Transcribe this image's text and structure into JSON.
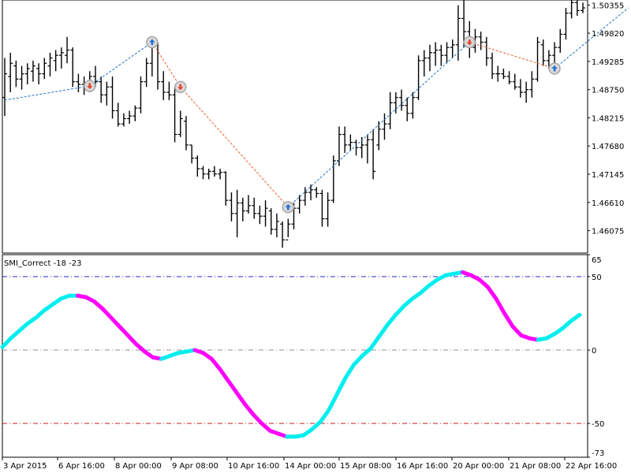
{
  "chart_data": [
    {
      "type": "ohlc",
      "price_ticks": [
        "1.50355",
        "1.49820",
        "1.49285",
        "1.48750",
        "1.48215",
        "1.47680",
        "1.47145",
        "1.46610",
        "1.46075"
      ],
      "ylim": [
        1.4565,
        1.5045
      ],
      "bars": [
        {
          "h": 1.4935,
          "l": 1.4825,
          "o": 1.486,
          "c": 1.4905
        },
        {
          "h": 1.4945,
          "l": 1.487,
          "o": 1.49,
          "c": 1.4925
        },
        {
          "h": 1.493,
          "l": 1.488,
          "o": 1.492,
          "c": 1.4895
        },
        {
          "h": 1.492,
          "l": 1.4875,
          "o": 1.4895,
          "c": 1.4905
        },
        {
          "h": 1.4925,
          "l": 1.4885,
          "o": 1.4905,
          "c": 1.4915
        },
        {
          "h": 1.493,
          "l": 1.489,
          "o": 1.491,
          "c": 1.492
        },
        {
          "h": 1.4925,
          "l": 1.4885,
          "o": 1.4915,
          "c": 1.4905
        },
        {
          "h": 1.4935,
          "l": 1.4895,
          "o": 1.4905,
          "c": 1.4925
        },
        {
          "h": 1.4945,
          "l": 1.49,
          "o": 1.492,
          "c": 1.4935
        },
        {
          "h": 1.495,
          "l": 1.491,
          "o": 1.493,
          "c": 1.494
        },
        {
          "h": 1.4955,
          "l": 1.4915,
          "o": 1.494,
          "c": 1.4945
        },
        {
          "h": 1.4975,
          "l": 1.4925,
          "o": 1.494,
          "c": 1.495
        },
        {
          "h": 1.4955,
          "l": 1.488,
          "o": 1.495,
          "c": 1.489
        },
        {
          "h": 1.4905,
          "l": 1.487,
          "o": 1.489,
          "c": 1.4885
        },
        {
          "h": 1.49,
          "l": 1.4865,
          "o": 1.4885,
          "c": 1.488
        },
        {
          "h": 1.491,
          "l": 1.487,
          "o": 1.488,
          "c": 1.49
        },
        {
          "h": 1.492,
          "l": 1.488,
          "o": 1.49,
          "c": 1.489
        },
        {
          "h": 1.49,
          "l": 1.485,
          "o": 1.489,
          "c": 1.4865
        },
        {
          "h": 1.489,
          "l": 1.4845,
          "o": 1.4865,
          "c": 1.488
        },
        {
          "h": 1.49,
          "l": 1.482,
          "o": 1.488,
          "c": 1.4835
        },
        {
          "h": 1.485,
          "l": 1.4805,
          "o": 1.4835,
          "c": 1.481
        },
        {
          "h": 1.483,
          "l": 1.4805,
          "o": 1.481,
          "c": 1.482
        },
        {
          "h": 1.4835,
          "l": 1.481,
          "o": 1.482,
          "c": 1.4825
        },
        {
          "h": 1.4845,
          "l": 1.4815,
          "o": 1.4825,
          "c": 1.484
        },
        {
          "h": 1.49,
          "l": 1.483,
          "o": 1.484,
          "c": 1.489
        },
        {
          "h": 1.4935,
          "l": 1.488,
          "o": 1.489,
          "c": 1.4925
        },
        {
          "h": 1.4975,
          "l": 1.49,
          "o": 1.4925,
          "c": 1.4965
        },
        {
          "h": 1.4965,
          "l": 1.4875,
          "o": 1.496,
          "c": 1.489
        },
        {
          "h": 1.491,
          "l": 1.4855,
          "o": 1.489,
          "c": 1.487
        },
        {
          "h": 1.489,
          "l": 1.4855,
          "o": 1.487,
          "c": 1.4865
        },
        {
          "h": 1.488,
          "l": 1.4775,
          "o": 1.4865,
          "c": 1.479
        },
        {
          "h": 1.4835,
          "l": 1.4785,
          "o": 1.479,
          "c": 1.482
        },
        {
          "h": 1.4825,
          "l": 1.476,
          "o": 1.4815,
          "c": 1.477
        },
        {
          "h": 1.477,
          "l": 1.4735,
          "o": 1.477,
          "c": 1.4745
        },
        {
          "h": 1.475,
          "l": 1.471,
          "o": 1.4745,
          "c": 1.4725
        },
        {
          "h": 1.473,
          "l": 1.4705,
          "o": 1.4725,
          "c": 1.4715
        },
        {
          "h": 1.4725,
          "l": 1.4705,
          "o": 1.4715,
          "c": 1.472
        },
        {
          "h": 1.473,
          "l": 1.471,
          "o": 1.472,
          "c": 1.4715
        },
        {
          "h": 1.4725,
          "l": 1.4705,
          "o": 1.4715,
          "c": 1.4718
        },
        {
          "h": 1.472,
          "l": 1.4655,
          "o": 1.4718,
          "c": 1.4665
        },
        {
          "h": 1.468,
          "l": 1.4625,
          "o": 1.4665,
          "c": 1.464
        },
        {
          "h": 1.4685,
          "l": 1.4595,
          "o": 1.464,
          "c": 1.466
        },
        {
          "h": 1.467,
          "l": 1.4625,
          "o": 1.466,
          "c": 1.4645
        },
        {
          "h": 1.4675,
          "l": 1.464,
          "o": 1.4645,
          "c": 1.4655
        },
        {
          "h": 1.467,
          "l": 1.463,
          "o": 1.4655,
          "c": 1.464
        },
        {
          "h": 1.4655,
          "l": 1.462,
          "o": 1.464,
          "c": 1.4635
        },
        {
          "h": 1.4665,
          "l": 1.4615,
          "o": 1.4635,
          "c": 1.465
        },
        {
          "h": 1.465,
          "l": 1.46,
          "o": 1.4645,
          "c": 1.461
        },
        {
          "h": 1.464,
          "l": 1.4595,
          "o": 1.461,
          "c": 1.4625
        },
        {
          "h": 1.4625,
          "l": 1.4575,
          "o": 1.462,
          "c": 1.459
        },
        {
          "h": 1.463,
          "l": 1.4595,
          "o": 1.459,
          "c": 1.462
        },
        {
          "h": 1.466,
          "l": 1.461,
          "o": 1.462,
          "c": 1.465
        },
        {
          "h": 1.4675,
          "l": 1.464,
          "o": 1.465,
          "c": 1.4665
        },
        {
          "h": 1.469,
          "l": 1.4655,
          "o": 1.4665,
          "c": 1.468
        },
        {
          "h": 1.4695,
          "l": 1.4665,
          "o": 1.468,
          "c": 1.4685
        },
        {
          "h": 1.469,
          "l": 1.467,
          "o": 1.4685,
          "c": 1.4678
        },
        {
          "h": 1.4685,
          "l": 1.4615,
          "o": 1.4678,
          "c": 1.463
        },
        {
          "h": 1.468,
          "l": 1.4615,
          "o": 1.463,
          "c": 1.4665
        },
        {
          "h": 1.475,
          "l": 1.466,
          "o": 1.4665,
          "c": 1.474
        },
        {
          "h": 1.4805,
          "l": 1.473,
          "o": 1.474,
          "c": 1.479
        },
        {
          "h": 1.4805,
          "l": 1.4755,
          "o": 1.479,
          "c": 1.477
        },
        {
          "h": 1.479,
          "l": 1.476,
          "o": 1.477,
          "c": 1.4775
        },
        {
          "h": 1.478,
          "l": 1.475,
          "o": 1.4775,
          "c": 1.4765
        },
        {
          "h": 1.4785,
          "l": 1.4745,
          "o": 1.4765,
          "c": 1.477
        },
        {
          "h": 1.479,
          "l": 1.4735,
          "o": 1.477,
          "c": 1.478
        },
        {
          "h": 1.48,
          "l": 1.4705,
          "o": 1.478,
          "c": 1.472
        },
        {
          "h": 1.4815,
          "l": 1.476,
          "o": 1.477,
          "c": 1.48
        },
        {
          "h": 1.483,
          "l": 1.478,
          "o": 1.48,
          "c": 1.481
        },
        {
          "h": 1.487,
          "l": 1.48,
          "o": 1.481,
          "c": 1.485
        },
        {
          "h": 1.487,
          "l": 1.483,
          "o": 1.485,
          "c": 1.486
        },
        {
          "h": 1.4875,
          "l": 1.4835,
          "o": 1.486,
          "c": 1.4845
        },
        {
          "h": 1.486,
          "l": 1.4815,
          "o": 1.4845,
          "c": 1.483
        },
        {
          "h": 1.487,
          "l": 1.482,
          "o": 1.483,
          "c": 1.486
        },
        {
          "h": 1.494,
          "l": 1.4855,
          "o": 1.486,
          "c": 1.493
        },
        {
          "h": 1.495,
          "l": 1.49,
          "o": 1.493,
          "c": 1.4935
        },
        {
          "h": 1.496,
          "l": 1.491,
          "o": 1.4935,
          "c": 1.4945
        },
        {
          "h": 1.4965,
          "l": 1.492,
          "o": 1.4945,
          "c": 1.495
        },
        {
          "h": 1.496,
          "l": 1.492,
          "o": 1.495,
          "c": 1.494
        },
        {
          "h": 1.4965,
          "l": 1.4925,
          "o": 1.494,
          "c": 1.4955
        },
        {
          "h": 1.497,
          "l": 1.4935,
          "o": 1.4955,
          "c": 1.496
        },
        {
          "h": 1.5035,
          "l": 1.493,
          "o": 1.496,
          "c": 1.501
        },
        {
          "h": 1.505,
          "l": 1.4955,
          "o": 1.501,
          "c": 1.4985
        },
        {
          "h": 1.5005,
          "l": 1.4935,
          "o": 1.4985,
          "c": 1.4955
        },
        {
          "h": 1.499,
          "l": 1.4945,
          "o": 1.4955,
          "c": 1.4975
        },
        {
          "h": 1.4985,
          "l": 1.495,
          "o": 1.4975,
          "c": 1.4965
        },
        {
          "h": 1.4975,
          "l": 1.492,
          "o": 1.4965,
          "c": 1.4935
        },
        {
          "h": 1.4945,
          "l": 1.4895,
          "o": 1.4935,
          "c": 1.4905
        },
        {
          "h": 1.492,
          "l": 1.489,
          "o": 1.4905,
          "c": 1.4905
        },
        {
          "h": 1.4915,
          "l": 1.4895,
          "o": 1.4905,
          "c": 1.49
        },
        {
          "h": 1.491,
          "l": 1.4885,
          "o": 1.49,
          "c": 1.489
        },
        {
          "h": 1.4905,
          "l": 1.4875,
          "o": 1.489,
          "c": 1.488
        },
        {
          "h": 1.4895,
          "l": 1.486,
          "o": 1.488,
          "c": 1.487
        },
        {
          "h": 1.489,
          "l": 1.485,
          "o": 1.487,
          "c": 1.4875
        },
        {
          "h": 1.491,
          "l": 1.486,
          "o": 1.4875,
          "c": 1.4895
        },
        {
          "h": 1.4975,
          "l": 1.489,
          "o": 1.4895,
          "c": 1.4965
        },
        {
          "h": 1.497,
          "l": 1.492,
          "o": 1.496,
          "c": 1.493
        },
        {
          "h": 1.495,
          "l": 1.4915,
          "o": 1.493,
          "c": 1.494
        },
        {
          "h": 1.4965,
          "l": 1.4925,
          "o": 1.494,
          "c": 1.4955
        },
        {
          "h": 1.499,
          "l": 1.4945,
          "o": 1.4955,
          "c": 1.498
        },
        {
          "h": 1.503,
          "l": 1.497,
          "o": 1.498,
          "c": 1.502
        },
        {
          "h": 1.505,
          "l": 1.501,
          "o": 1.502,
          "c": 1.504
        },
        {
          "h": 1.5045,
          "l": 1.5015,
          "o": 1.504,
          "c": 1.5025
        },
        {
          "h": 1.504,
          "l": 1.502,
          "o": 1.5025,
          "c": 1.503
        }
      ],
      "zigzag": [
        {
          "bar": 0,
          "price": 1.4855
        },
        {
          "bar": 15,
          "price": 1.4882
        },
        {
          "bar": 26,
          "price": 1.4965
        },
        {
          "bar": 31,
          "price": 1.488
        },
        {
          "bar": 50,
          "price": 1.4652
        },
        {
          "bar": 82,
          "price": 1.4965
        },
        {
          "bar": 97,
          "price": 1.4915
        },
        {
          "bar": 110,
          "price": 1.503
        }
      ],
      "markers": [
        {
          "bar": 15,
          "price": 1.4882,
          "dir": "down"
        },
        {
          "bar": 26,
          "price": 1.4965,
          "dir": "up"
        },
        {
          "bar": 31,
          "price": 1.488,
          "dir": "down"
        },
        {
          "bar": 50,
          "price": 1.4652,
          "dir": "up"
        },
        {
          "bar": 82,
          "price": 1.4965,
          "dir": "down"
        },
        {
          "bar": 97,
          "price": 1.4915,
          "dir": "up"
        }
      ],
      "colors": {
        "up_line": "#1e73c8",
        "down_line": "#e8602c",
        "bars": "#000000",
        "marker_up": "#1e6fd9",
        "marker_down": "#e8402c"
      }
    },
    {
      "type": "line",
      "title": "SMI_Correct -18 -23",
      "ylim": [
        -73,
        65
      ],
      "y_ticks": [
        "65",
        "50",
        "0",
        "-50",
        "-73"
      ],
      "levels": [
        {
          "value": 50,
          "color": "#2a2ad0"
        },
        {
          "value": 0,
          "color": "#909090"
        },
        {
          "value": -50,
          "color": "#d42020"
        }
      ],
      "x_ticks": [
        "3 Apr 2015",
        "6 Apr 16:00",
        "8 Apr 00:00",
        "9 Apr 08:00",
        "10 Apr 16:00",
        "14 Apr 00:00",
        "15 Apr 08:00",
        "16 Apr 16:00",
        "20 Apr 00:00",
        "21 Apr 08:00",
        "22 Apr 16:00"
      ],
      "series": [
        {
          "color_rising": "#00eeee",
          "color_falling": "#ff00ff",
          "values": [
            2,
            8,
            13,
            18,
            22,
            27,
            31,
            35,
            37,
            37,
            36,
            33,
            28,
            22,
            16,
            10,
            4,
            -1,
            -5,
            -6,
            -4,
            -2,
            -1,
            0,
            -2,
            -6,
            -13,
            -21,
            -29,
            -37,
            -44,
            -50,
            -55,
            -57,
            -59,
            -59,
            -58,
            -54,
            -49,
            -41,
            -30,
            -19,
            -10,
            -4,
            1,
            9,
            17,
            24,
            30,
            35,
            39,
            44,
            48,
            51,
            52,
            53,
            51,
            48,
            43,
            35,
            25,
            16,
            10,
            8,
            7,
            8,
            11,
            15,
            20,
            24
          ]
        }
      ]
    }
  ]
}
